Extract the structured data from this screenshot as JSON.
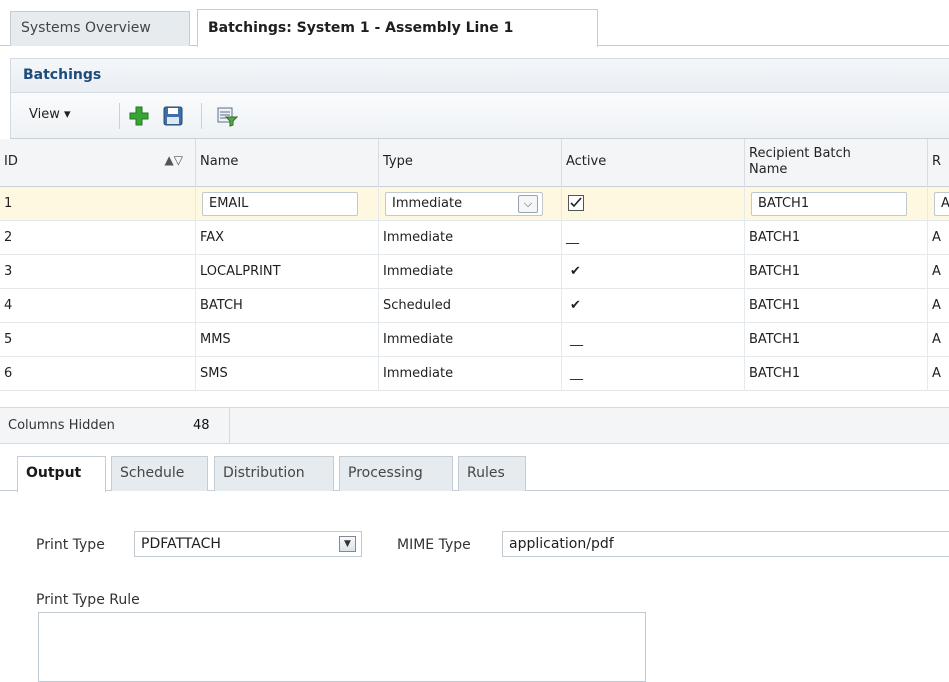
{
  "tabs": {
    "overview": "Systems Overview",
    "active": "Batchings: System 1 - Assembly Line 1"
  },
  "panel": {
    "title": "Batchings"
  },
  "toolbar": {
    "view_label": "View ▾"
  },
  "table": {
    "headers": {
      "id": "ID",
      "name": "Name",
      "type": "Type",
      "active": "Active",
      "recipient_line1": "Recipient Batch",
      "recipient_line2": "Name",
      "next": "R"
    },
    "rows": [
      {
        "id": "1",
        "name": "EMAIL",
        "type": "Immediate",
        "active": "checked",
        "recipient": "BATCH1",
        "next": "A"
      },
      {
        "id": "2",
        "name": "FAX",
        "type": "Immediate",
        "active": "__",
        "recipient": "BATCH1",
        "next": "A"
      },
      {
        "id": "3",
        "name": "LOCALPRINT",
        "type": "Immediate",
        "active": "✔",
        "recipient": "BATCH1",
        "next": "A"
      },
      {
        "id": "4",
        "name": "BATCH",
        "type": "Scheduled",
        "active": "✔",
        "recipient": "BATCH1",
        "next": "A"
      },
      {
        "id": "5",
        "name": "MMS",
        "type": "Immediate",
        "active": "__",
        "recipient": "BATCH1",
        "next": "A"
      },
      {
        "id": "6",
        "name": "SMS",
        "type": "Immediate",
        "active": "__",
        "recipient": "BATCH1",
        "next": "A"
      }
    ]
  },
  "status": {
    "label": "Columns Hidden",
    "value": "48"
  },
  "subtabs": [
    "Output",
    "Schedule",
    "Distribution",
    "Processing",
    "Rules"
  ],
  "form": {
    "print_type_label": "Print Type",
    "print_type_value": "PDFATTACH",
    "mime_type_label": "MIME Type",
    "mime_type_value": "application/pdf",
    "print_type_rule_label": "Print Type Rule",
    "print_type_rule_value": ""
  },
  "colors": {
    "title_blue": "#1d4b7a",
    "selected_row": "#fff8e1",
    "add_green": "#3aa335"
  }
}
